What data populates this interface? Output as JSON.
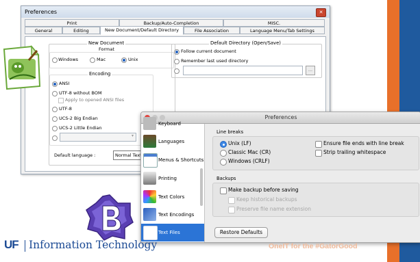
{
  "notepadpp": {
    "title": "Preferences",
    "tabs_row1": [
      "Print",
      "Backup/Auto-Completion",
      "MISC."
    ],
    "tabs_row2": [
      "General",
      "Editing",
      "New Document/Default Directory",
      "File Association",
      "Language Menu/Tab Settings"
    ],
    "active_tab": "New Document/Default Directory",
    "new_document": {
      "caption": "New Document",
      "format": {
        "caption": "Format",
        "options": [
          "Windows",
          "Mac",
          "Unix"
        ],
        "selected": "Unix"
      },
      "encoding": {
        "caption": "Encoding",
        "ansi": "ANSI",
        "utf8_no_bom": "UTF-8 without BOM",
        "apply_ansi": "Apply to opened ANSI files",
        "utf8": "UTF-8",
        "ucs2_be": "UCS-2 Big Endian",
        "ucs2_le": "UCS-2 Little Endian",
        "selected": "ANSI"
      },
      "default_language_label": "Default language :",
      "default_language_value": "Normal Text"
    },
    "default_directory": {
      "caption": "Default Directory (Open/Save)",
      "follow": "Follow current document",
      "remember": "Remember last used directory",
      "browse_label": "...",
      "selected": "Follow current document"
    }
  },
  "bbedit": {
    "title": "Preferences",
    "sidebar": [
      {
        "label": "Keyboard",
        "icon": "keyboard-icon"
      },
      {
        "label": "Languages",
        "icon": "languages-icon"
      },
      {
        "label": "Menus & Shortcuts",
        "icon": "menus-icon"
      },
      {
        "label": "Printing",
        "icon": "printer-icon"
      },
      {
        "label": "Text Colors",
        "icon": "text-colors-icon"
      },
      {
        "label": "Text Encodings",
        "icon": "text-encodings-icon"
      },
      {
        "label": "Text Files",
        "icon": "text-files-icon"
      }
    ],
    "selected_sidebar": "Text Files",
    "search_placeholder": "",
    "line_breaks": {
      "caption": "Line breaks",
      "options": [
        "Unix (LF)",
        "Classic Mac (CR)",
        "Windows (CRLF)"
      ],
      "selected": "Unix (LF)",
      "ensure_newline": "Ensure file ends with line break",
      "strip_trailing": "Strip trailing whitespace"
    },
    "backups": {
      "caption": "Backups",
      "make_backup": "Make backup before saving",
      "keep_historical": "Keep historical backups",
      "preserve_ext": "Preserve file name extension"
    },
    "restore_button": "Restore Defaults"
  },
  "branding": {
    "uf_mark": "UF",
    "uf_text": "Information Technology",
    "tagline": "OneIT for the #GatorGood",
    "accent_orange": "#e8702a",
    "accent_blue": "#1f5a9e"
  }
}
